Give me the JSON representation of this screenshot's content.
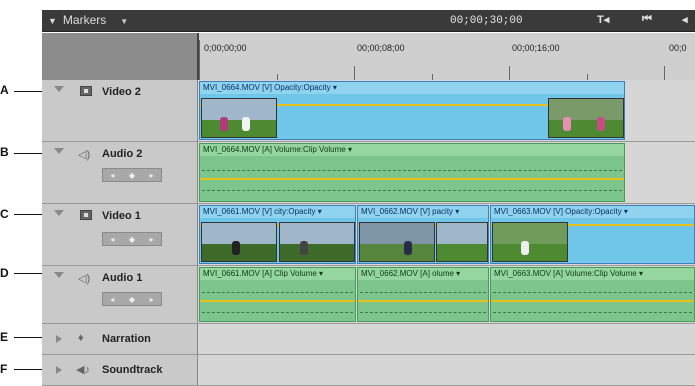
{
  "topbar": {
    "markers_label": "Markers",
    "timecode": "00;00;30;00",
    "buttons": [
      "T◂",
      "⏮",
      "◂"
    ]
  },
  "ruler": {
    "labels": [
      "0;00;00;00",
      "00;00;08;00",
      "00;00;16;00",
      "00;0"
    ]
  },
  "callouts": [
    "A",
    "B",
    "C",
    "D",
    "E",
    "F"
  ],
  "tracks": {
    "video2": {
      "name": "Video 2",
      "clip_label": "MVI_0664.MOV [V]  Opacity:Opacity ▾"
    },
    "audio2": {
      "name": "Audio 2",
      "clip_label": "MVI_0664.MOV [A]  Volume:Clip Volume ▾"
    },
    "video1": {
      "name": "Video 1",
      "clips": [
        "MVI_0661.MOV [V]  city:Opacity ▾",
        "MVI_0662.MOV [V]  pacity ▾",
        "MVI_0663.MOV [V]  Opacity:Opacity ▾"
      ]
    },
    "audio1": {
      "name": "Audio 1",
      "clips": [
        "MVI_0661.MOV [A]  Clip Volume ▾",
        "MVI_0662.MOV [A]  olume ▾",
        "MVI_0663.MOV [A]  Volume:Clip Volume ▾"
      ]
    },
    "narration": {
      "name": "Narration"
    },
    "soundtrack": {
      "name": "Soundtrack"
    }
  },
  "keyframe_controls": [
    "◂",
    "◆",
    "▸"
  ],
  "colors": {
    "video_clip": "#6fc6e8",
    "audio_clip": "#7cc68b",
    "volume_line": "#e8c01a",
    "topbar": "#3a3a3a"
  }
}
